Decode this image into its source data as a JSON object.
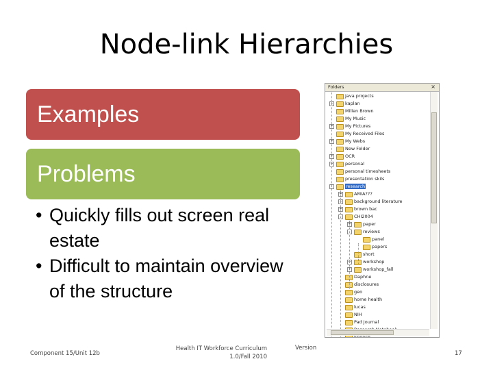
{
  "slide": {
    "title": "Node-link Hierarchies",
    "band_examples": "Examples",
    "band_problems": "Problems",
    "bullets": [
      "Quickly fills out screen real estate",
      "Difficult to maintain overview of the structure"
    ],
    "bullet_char": "•",
    "colors": {
      "examples": "#c0504d",
      "problems": "#9bbb59"
    }
  },
  "footer": {
    "left": "Component 15/Unit 12b",
    "middle_line1": "Health IT Workforce Curriculum",
    "middle_line2": "1.0/Fall 2010",
    "version": "Version",
    "page": "17"
  },
  "tree": {
    "header": "Folders",
    "close": "×",
    "items": [
      {
        "label": "Java projects",
        "level": 0,
        "expander": ""
      },
      {
        "label": "kaplan",
        "level": 0,
        "expander": "+"
      },
      {
        "label": "Millen Brown",
        "level": 0,
        "expander": ""
      },
      {
        "label": "My Music",
        "level": 0,
        "expander": ""
      },
      {
        "label": "My Pictures",
        "level": 0,
        "expander": "+"
      },
      {
        "label": "My Received Files",
        "level": 0,
        "expander": ""
      },
      {
        "label": "My Webs",
        "level": 0,
        "expander": "+"
      },
      {
        "label": "New Folder",
        "level": 0,
        "expander": ""
      },
      {
        "label": "OCR",
        "level": 0,
        "expander": "+"
      },
      {
        "label": "personal",
        "level": 0,
        "expander": "+"
      },
      {
        "label": "personal timesheets",
        "level": 0,
        "expander": ""
      },
      {
        "label": "presentation skils",
        "level": 0,
        "expander": ""
      },
      {
        "label": "research",
        "level": 0,
        "expander": "-",
        "selected": true
      },
      {
        "label": "AMIA???",
        "level": 1,
        "expander": "+"
      },
      {
        "label": "background literature",
        "level": 1,
        "expander": "+"
      },
      {
        "label": "brown bac",
        "level": 1,
        "expander": "+"
      },
      {
        "label": "CHI2004",
        "level": 1,
        "expander": "-"
      },
      {
        "label": "paper",
        "level": 2,
        "expander": "+"
      },
      {
        "label": "reviews",
        "level": 2,
        "expander": "-"
      },
      {
        "label": "panel",
        "level": 3,
        "expander": ""
      },
      {
        "label": "papers",
        "level": 3,
        "expander": ""
      },
      {
        "label": "short",
        "level": 2,
        "expander": ""
      },
      {
        "label": "workshop",
        "level": 2,
        "expander": "+"
      },
      {
        "label": "workshop_fall",
        "level": 2,
        "expander": "+"
      },
      {
        "label": "Daphne",
        "level": 1,
        "expander": ""
      },
      {
        "label": "disclosures",
        "level": 1,
        "expander": ""
      },
      {
        "label": "geo",
        "level": 1,
        "expander": ""
      },
      {
        "label": "home health",
        "level": 1,
        "expander": ""
      },
      {
        "label": "lucas",
        "level": 1,
        "expander": ""
      },
      {
        "label": "NIH",
        "level": 1,
        "expander": ""
      },
      {
        "label": "Pad Journal",
        "level": 1,
        "expander": ""
      },
      {
        "label": "Research Notebook",
        "level": 1,
        "expander": ""
      },
      {
        "label": "Speech",
        "level": 1,
        "expander": ""
      }
    ]
  }
}
